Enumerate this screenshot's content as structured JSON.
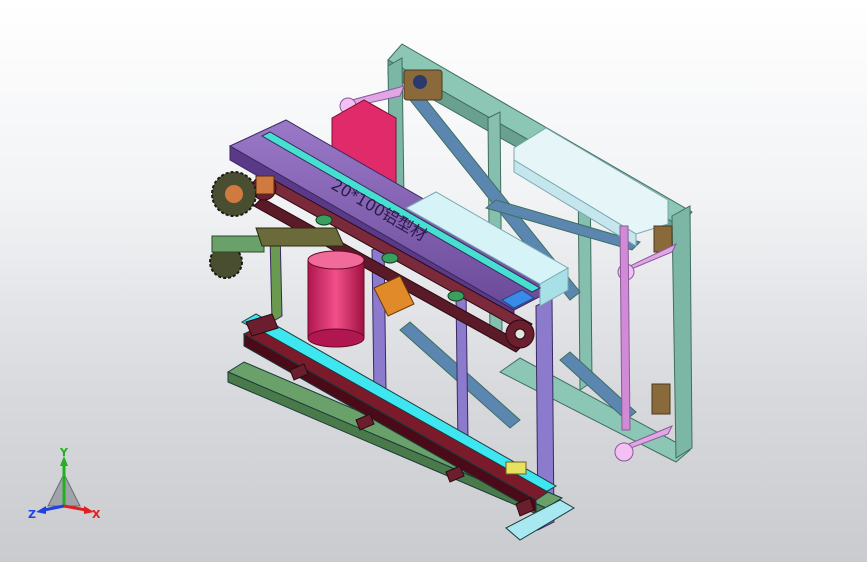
{
  "model": {
    "engraved_text": "20*100铝型材",
    "colors": {
      "frame": "#7fb8a8",
      "frame_edge": "#3f6e60",
      "beam": "#7a5aa8",
      "belt": "#6a1e2e",
      "motor": "#e0326e",
      "base": "#6aa06a",
      "guide": "#3ee6f0",
      "rod": "#d8a0e0",
      "panel": "#d4f4f8"
    }
  },
  "triad": {
    "x_label": "X",
    "y_label": "Y",
    "z_label": "Z",
    "x_color": "#e02020",
    "y_color": "#20b020",
    "z_color": "#2040e0"
  }
}
